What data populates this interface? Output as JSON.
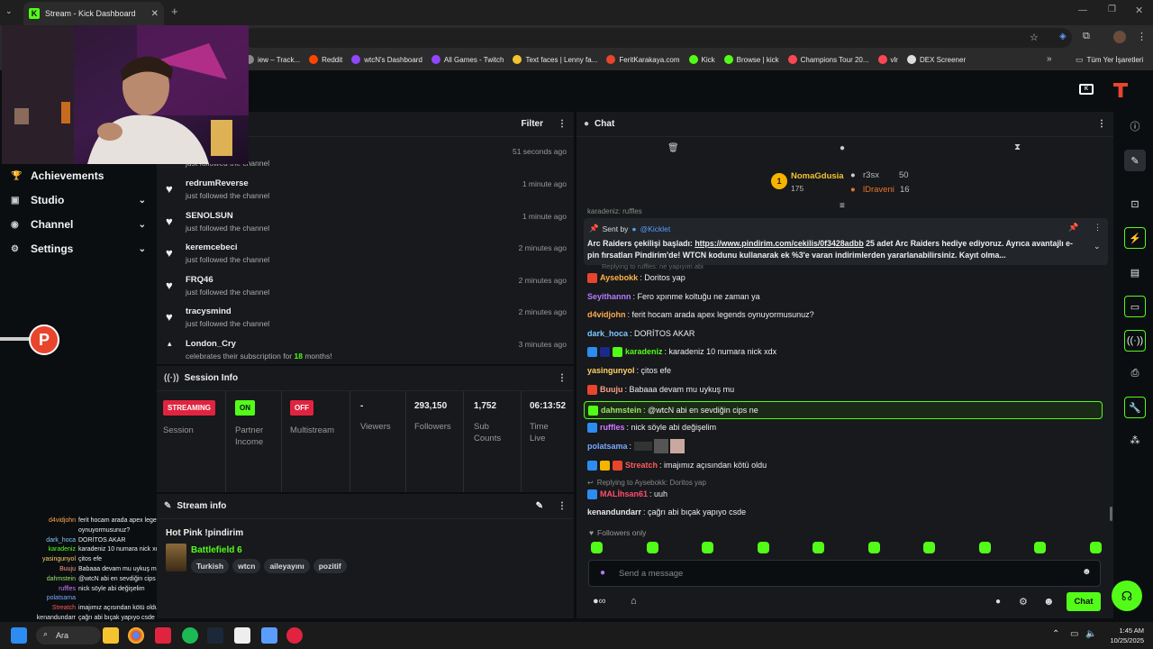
{
  "browser": {
    "tab_title": "Stream - Kick Dashboard",
    "bookmarks": [
      {
        "label": "iew – Track...",
        "color": "#888888"
      },
      {
        "label": "Reddit",
        "color": "#ff4500"
      },
      {
        "label": "wtcN's Dashboard",
        "color": "#9146ff"
      },
      {
        "label": "All Games - Twitch",
        "color": "#9146ff"
      },
      {
        "label": "Text faces | Lenny fa...",
        "color": "#f4c430"
      },
      {
        "label": "FeritKarakaya.com",
        "color": "#e8452c"
      },
      {
        "label": "Kick",
        "color": "#53fc18"
      },
      {
        "label": "Browse | kick",
        "color": "#53fc18"
      },
      {
        "label": "Champions Tour 20...",
        "color": "#ff4655"
      },
      {
        "label": "vlr",
        "color": "#ff4655"
      },
      {
        "label": "DEX Screener",
        "color": "#dddddd"
      }
    ],
    "other_bookmarks": "Tüm Yer İşaretleri"
  },
  "sidebar": {
    "items": [
      {
        "label": "Achievements",
        "icon": "trophy-icon",
        "chevron": false
      },
      {
        "label": "Studio",
        "icon": "video-icon",
        "chevron": true
      },
      {
        "label": "Channel",
        "icon": "broadcast-icon",
        "chevron": true
      },
      {
        "label": "Settings",
        "icon": "gear-icon",
        "chevron": true
      }
    ]
  },
  "activity": {
    "filter_label": "Filter",
    "first_time": "51 seconds ago",
    "first_sub": "just followed the channel",
    "items": [
      {
        "name": "redrumReverse",
        "action": "just followed the channel",
        "time": "1 minute ago"
      },
      {
        "name": "SENOLSUN",
        "action": "just followed the channel",
        "time": "1 minute ago"
      },
      {
        "name": "keremcebeci",
        "action": "just followed the channel",
        "time": "2 minutes ago"
      },
      {
        "name": "FRQ46",
        "action": "just followed the channel",
        "time": "2 minutes ago"
      },
      {
        "name": "tracysmind",
        "action": "just followed the channel",
        "time": "2 minutes ago"
      }
    ],
    "sub_item": {
      "name": "London_Cry",
      "action_pre": "celebrates their subscription for ",
      "months": "18",
      "action_post": " months!",
      "time": "3 minutes ago"
    }
  },
  "session": {
    "title": "Session Info",
    "session_badge": "STREAMING",
    "session_label": "Session",
    "partner_badge": "ON",
    "partner_label": "Partner Income",
    "multistream_badge": "OFF",
    "multistream_label": "Multistream",
    "viewers_value": "-",
    "viewers_label": "Viewers",
    "followers_value": "293,150",
    "followers_label": "Followers",
    "subs_value": "1,752",
    "subs_label": "Sub Counts",
    "time_value": "06:13:52",
    "time_label": "Time Live"
  },
  "stream_info": {
    "title": "Stream info",
    "stream_title": "Hot Pink !pindirim",
    "game": "Battlefield 6",
    "tags": [
      "Turkish",
      "wtcn",
      "aileyayını",
      "pozitif"
    ]
  },
  "chat": {
    "title": "Chat",
    "leaderboard": {
      "rank1_name": "NomaGdusia",
      "rank1_points": "175",
      "rank2_name": "r3sx",
      "rank2_points": "50",
      "rank3_name": "lDraveni",
      "rank3_points": "16"
    },
    "partial_line": "karadeniz: ruffles",
    "pinned": {
      "sent_by": "Sent by",
      "sender": "@Kicklet",
      "text_pre": "Arc Raiders çekilişi başladı: ",
      "link": "https://www.pindirim.com/cekilis/0f3428adbb",
      "text_post": " 25 adet Arc Raiders hediye ediyoruz. Ayrıca avantajlı e-pin fırsatları Pindirim'de! WTCN kodunu kullanarak ek %3'e varan indirimlerden yararlanabilirsiniz. Kayıt olma..."
    },
    "faded_reply": "Replying to ruffles: ne yapıyım abi",
    "messages": [
      {
        "user": "Aysebokk",
        "text": "Doritos yap",
        "color": "#ffb347"
      },
      {
        "user": "Seyithannn",
        "text": "Fero xpınme koltuğu ne zaman ya",
        "color": "#b57bff"
      },
      {
        "user": "d4vidjohn",
        "text": "ferit hocam arada apex legends oynuyormusunuz?",
        "color": "#ffa94d"
      },
      {
        "user": "dark_hoca",
        "text": "DORİTOS AKAR",
        "color": "#7ec8ff"
      },
      {
        "user": "karadeniz",
        "text": "karadeniz 10 numara nick xdx",
        "color": "#53fc18"
      },
      {
        "user": "yasingunyol",
        "text": "çitos efe",
        "color": "#ffd166"
      },
      {
        "user": "Buuju",
        "text": "Babaaa devam mu uykuş mu",
        "color": "#ff9f80"
      },
      {
        "user": "dahmstein",
        "text": "@wtcN abi en sevdiğin cips ne",
        "color": "#9be36b"
      },
      {
        "user": "ruffles",
        "text": "nick söyle abi değişelim",
        "color": "#d17bff"
      },
      {
        "user": "polatsama",
        "text": "",
        "color": "#7aa8ff"
      },
      {
        "user": "Streatch",
        "text": "imajımız açısından kötü oldu",
        "color": "#ff5a5a"
      },
      {
        "user": "MALİhsan61",
        "text": "uuh",
        "color": "#ff4d6d"
      },
      {
        "user": "kenandundarr",
        "text": "çağrı abi bıçak yapıyo csde",
        "color": "#e8e8e8"
      }
    ],
    "reply_to": "Replying to Aysebokk: Doritos yap",
    "followers_only": "Followers only",
    "input_placeholder": "Send a message",
    "chat_button": "Chat"
  },
  "overlay_chat": [
    {
      "name": "d4vidjohn",
      "text": "ferit hocam arada apex legends",
      "color": "#ffa94d"
    },
    {
      "name": "",
      "text": "oynuyormusunuz?",
      "color": "#ffa94d"
    },
    {
      "name": "dark_hoca",
      "text": "DORİTOS AKAR",
      "color": "#7ec8ff"
    },
    {
      "name": "karadeniz",
      "text": "karadeniz 10 numara nick xdx",
      "color": "#53fc18"
    },
    {
      "name": "yasingunyol",
      "text": "çitos efe",
      "color": "#ffd166"
    },
    {
      "name": "Buuju",
      "text": "Babaaa devam mu uykuş mu",
      "color": "#ff9f80"
    },
    {
      "name": "dahmstein",
      "text": "@wtcN abi en sevdiğin cips ne",
      "color": "#9be36b"
    },
    {
      "name": "ruffles",
      "text": "nick söyle abi değişelim",
      "color": "#d17bff"
    },
    {
      "name": "polatsama",
      "text": "",
      "color": "#7aa8ff"
    },
    {
      "name": "Streatch",
      "text": "imajımız açısından kötü oldu",
      "color": "#ff5a5a"
    },
    {
      "name": "kenandundarr",
      "text": "çağrı abi bıçak yapıyo csde",
      "color": "#e8e8e8"
    }
  ],
  "taskbar": {
    "search_label": "Ara",
    "time": "1:45 AM",
    "date": "10/25/2025"
  },
  "colors": {
    "kick_green": "#53fc18",
    "streaming_red": "#e0243f",
    "panel_bg": "#17191c"
  }
}
